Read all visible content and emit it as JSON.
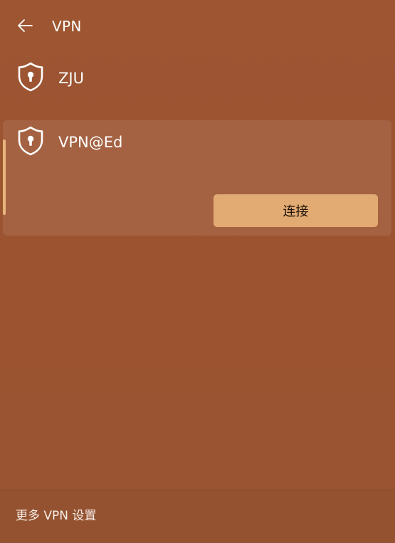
{
  "header": {
    "title": "VPN",
    "back_icon": "arrow-left-icon"
  },
  "vpn_list": [
    {
      "name": "ZJU",
      "icon": "shield-lock-icon",
      "selected": false
    },
    {
      "name": "VPN@Ed",
      "icon": "shield-lock-icon",
      "selected": true,
      "action_label": "连接"
    }
  ],
  "footer": {
    "link_label": "更多 VPN 设置"
  },
  "colors": {
    "background": "#9b5431",
    "accent": "#e7b57c",
    "button": "#e2ab73",
    "button_text": "#1e1208",
    "text": "#ffffff"
  }
}
